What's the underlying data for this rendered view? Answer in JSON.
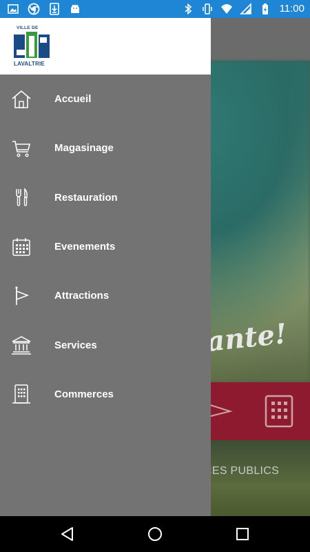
{
  "status_bar": {
    "time": "11:00",
    "left_icons": [
      "image-icon",
      "chrome-icon",
      "download-icon",
      "android-icon"
    ],
    "right_icons": [
      "bluetooth-icon",
      "vibrate-icon",
      "wifi-icon",
      "signal-icon",
      "battery-icon"
    ],
    "color": "#1f86d6"
  },
  "drawer": {
    "logo": {
      "line1": "VILLE DE",
      "line2": "LAVALTRIE"
    },
    "items": [
      {
        "label": "Accueil",
        "icon": "home-icon"
      },
      {
        "label": "Magasinage",
        "icon": "shopping-cart-icon"
      },
      {
        "label": "Restauration",
        "icon": "fork-knife-icon"
      },
      {
        "label": "Evenements",
        "icon": "calendar-icon"
      },
      {
        "label": "Attractions",
        "icon": "flag-icon"
      },
      {
        "label": "Services",
        "icon": "bank-icon"
      },
      {
        "label": "Commerces",
        "icon": "building-icon"
      }
    ],
    "background": "#737373"
  },
  "background_app": {
    "hero_text": "ante!",
    "band_label": "CES PUBLICS",
    "band_color": "#8d1a2e"
  },
  "nav_bar": {
    "buttons": [
      "back-icon",
      "home-circle-icon",
      "recents-icon"
    ]
  }
}
